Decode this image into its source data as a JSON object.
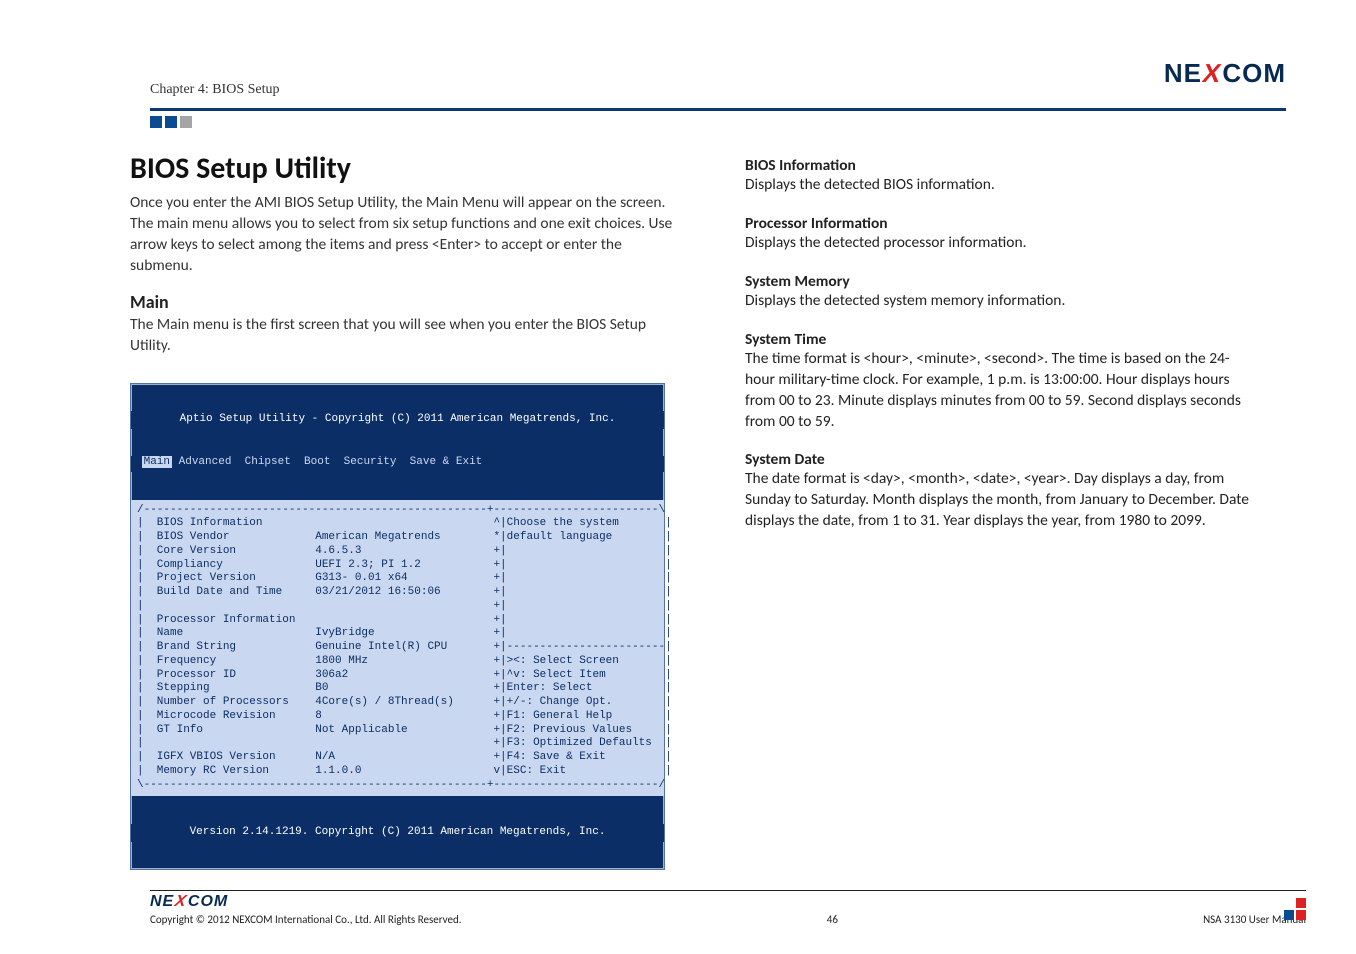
{
  "header": {
    "chapter": "Chapter 4: BIOS Setup",
    "logo_text_parts": {
      "pre": "NE",
      "x": "X",
      "post": "COM"
    }
  },
  "left": {
    "title": "BIOS Setup Utility",
    "intro": "Once you enter the AMI BIOS Setup Utility, the Main Menu will appear on the screen. The main menu allows you to select from six setup functions and one exit choices. Use arrow keys to select among the items and press <Enter> to accept or enter the submenu.",
    "main_heading": "Main",
    "main_para": "The Main menu is the first screen that you will see when you enter the BIOS Setup Utility."
  },
  "bios": {
    "titlebar": "Aptio Setup Utility - Copyright (C) 2011 American Megatrends, Inc.",
    "menu_selected": "Main",
    "menu_rest": " Advanced  Chipset  Boot  Security  Save & Exit",
    "divider_top": "/----------------------------------------------------+-------------------------\\",
    "rows": [
      "|  BIOS Information                                   ^|Choose the system       |",
      "|  BIOS Vendor             American Megatrends        *|default language        |",
      "|  Core Version            4.6.5.3                    +|                        |",
      "|  Compliancy              UEFI 2.3; PI 1.2           +|                        |",
      "|  Project Version         G313- 0.01 x64             +|                        |",
      "|  Build Date and Time     03/21/2012 16:50:06        +|                        |",
      "|                                                     +|                        |",
      "|  Processor Information                              +|                        |",
      "|  Name                    IvyBridge                  +|                        |",
      "|  Brand String            Genuine Intel(R) CPU       +|------------------------|",
      "|  Frequency               1800 MHz                   +|><: Select Screen       |",
      "|  Processor ID            306a2                      +|^v: Select Item         |",
      "|  Stepping                B0                         +|Enter: Select           |",
      "|  Number of Processors    4Core(s) / 8Thread(s)      +|+/-: Change Opt.        |",
      "|  Microcode Revision      8                          +|F1: General Help        |",
      "|  GT Info                 Not Applicable             +|F2: Previous Values     |",
      "|                                                     +|F3: Optimized Defaults  |",
      "|  IGFX VBIOS Version      N/A                        +|F4: Save & Exit         |",
      "|  Memory RC Version       1.1.0.0                    v|ESC: Exit               |"
    ],
    "divider_bottom": "\\----------------------------------------------------+-------------------------/",
    "footer": "Version 2.14.1219. Copyright (C) 2011 American Megatrends, Inc."
  },
  "right": {
    "items": [
      {
        "term": "BIOS Information",
        "desc": "Displays the detected BIOS information."
      },
      {
        "term": "Processor Information",
        "desc": "Displays the detected processor information."
      },
      {
        "term": "System Memory",
        "desc": "Displays the detected system memory information."
      },
      {
        "term": "System Time",
        "desc": "The time format is <hour>, <minute>, <second>. The time is based on the 24-hour military-time clock. For example, 1 p.m. is 13:00:00. Hour displays hours from 00 to 23. Minute displays minutes from 00 to 59. Second displays seconds from 00 to 59."
      },
      {
        "term": "System Date",
        "desc": "The date format is <day>, <month>, <date>, <year>. Day displays a day, from Sunday to Saturday. Month displays the month, from January to December. Date displays the date, from 1 to 31. Year displays the year, from 1980 to 2099."
      }
    ]
  },
  "footer": {
    "copyright": "Copyright © 2012 NEXCOM International Co., Ltd. All Rights Reserved.",
    "page": "46",
    "doc": "NSA 3130 User Manual"
  }
}
